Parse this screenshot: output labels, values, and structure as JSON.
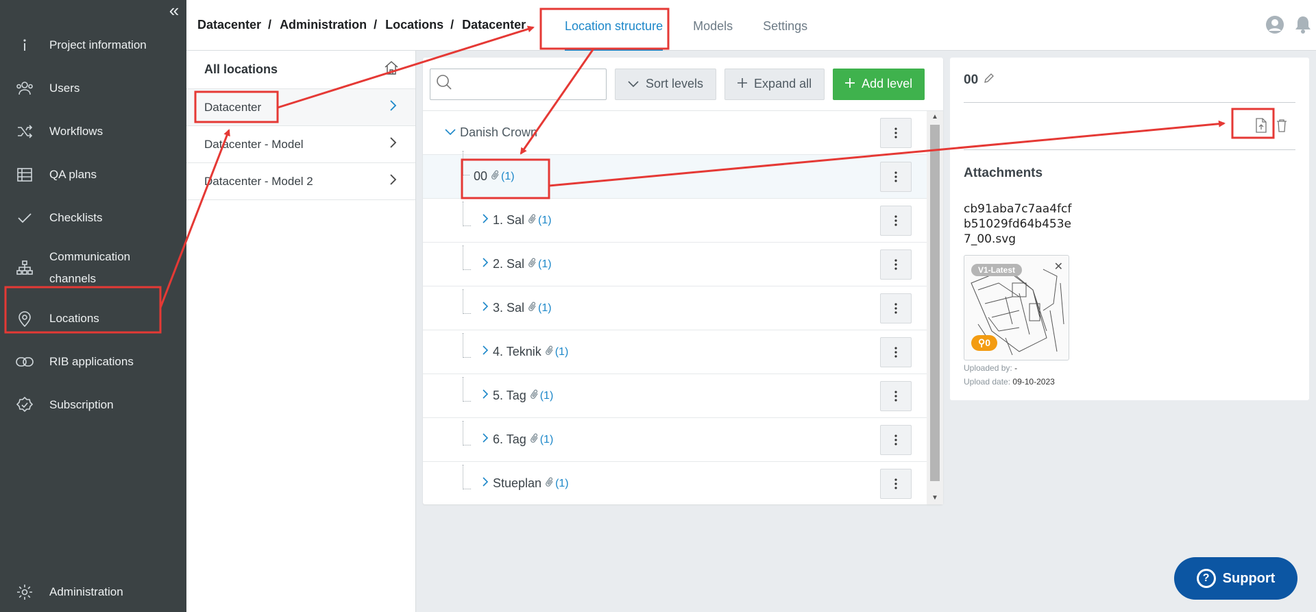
{
  "sidebar": {
    "collapse_icon": "«",
    "items": [
      {
        "label": "Project information",
        "icon": "info-icon"
      },
      {
        "label": "Users",
        "icon": "users-icon"
      },
      {
        "label": "Workflows",
        "icon": "shuffle-icon"
      },
      {
        "label": "QA plans",
        "icon": "table-icon"
      },
      {
        "label": "Checklists",
        "icon": "check-icon"
      },
      {
        "label": "Communication channels",
        "icon": "hierarchy-icon"
      },
      {
        "label": "Locations",
        "icon": "location-pin-icon"
      },
      {
        "label": "RIB applications",
        "icon": "link-icon"
      },
      {
        "label": "Subscription",
        "icon": "badge-check-icon"
      }
    ],
    "bottom_item": {
      "label": "Administration",
      "icon": "gear-icon"
    }
  },
  "header": {
    "breadcrumb": [
      "Datacenter",
      "Administration",
      "Locations",
      "Datacenter"
    ],
    "separator": "/",
    "tabs": [
      "Location structure",
      "Models",
      "Settings"
    ],
    "active_tab": "Location structure"
  },
  "locations": {
    "title": "All locations",
    "items": [
      "Datacenter",
      "Datacenter - Model",
      "Datacenter - Model 2"
    ]
  },
  "toolbar": {
    "search_placeholder": "",
    "sort_label": "Sort levels",
    "expand_label": "Expand all",
    "add_label": "Add level"
  },
  "tree": {
    "root": "Danish Crown",
    "selected": {
      "name": "00",
      "attachments": "(1)"
    },
    "levels": [
      {
        "name": "1. Sal",
        "attachments": "(1)"
      },
      {
        "name": "2. Sal",
        "attachments": "(1)"
      },
      {
        "name": "3. Sal",
        "attachments": "(1)"
      },
      {
        "name": "4. Teknik",
        "attachments": "(1)"
      },
      {
        "name": "5. Tag",
        "attachments": "(1)"
      },
      {
        "name": "6. Tag",
        "attachments": "(1)"
      },
      {
        "name": "Stueplan",
        "attachments": "(1)"
      }
    ]
  },
  "detail": {
    "title": "00",
    "attachments_title": "Attachments",
    "file_name": "cb91aba7c7aa4fcfb51029fd64b453e7_00.svg",
    "version_badge": "V1-Latest",
    "pin_count": "0",
    "uploaded_by_label": "Uploaded by:",
    "uploaded_by": "-",
    "upload_date_label": "Upload date:",
    "upload_date": "09-10-2023"
  },
  "support": {
    "label": "Support"
  },
  "colors": {
    "sidebar_bg": "#3b4244",
    "accent": "#1c87c9",
    "add_button": "#3fb24d",
    "support_button": "#0c56a3",
    "annotation_red": "#e53935",
    "pin_badge": "#f39c12"
  }
}
